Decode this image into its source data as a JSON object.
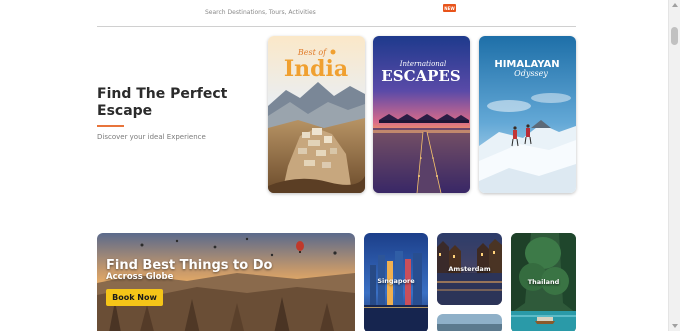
{
  "search": {
    "placeholder_text": "Search Destinations, Tours, Activities",
    "badge": "NEW"
  },
  "hero": {
    "title": "Find The Perfect Escape",
    "subtitle": "Discover your ideal Experience",
    "accent_color": "#e8743b"
  },
  "destinations": [
    {
      "name": "india-card",
      "pre_label": "Best of",
      "label": "India",
      "accent": "#f0a030"
    },
    {
      "name": "international-escapes-card",
      "pre_label": "International",
      "label": "ESCAPES",
      "accent": "#ffffff"
    },
    {
      "name": "himalayan-card",
      "pre_label": "",
      "label": "HIMALAYAN",
      "script_label": "Odyssey",
      "accent": "#ffffff"
    }
  ],
  "banner": {
    "title": "Find Best Things to Do",
    "subtitle": "Accross Globe",
    "button_label": "Book Now",
    "button_color": "#f5c518"
  },
  "cities": [
    {
      "label": "Singapore"
    },
    {
      "label": "Amsterdam"
    },
    {
      "label": "Thailand"
    }
  ]
}
